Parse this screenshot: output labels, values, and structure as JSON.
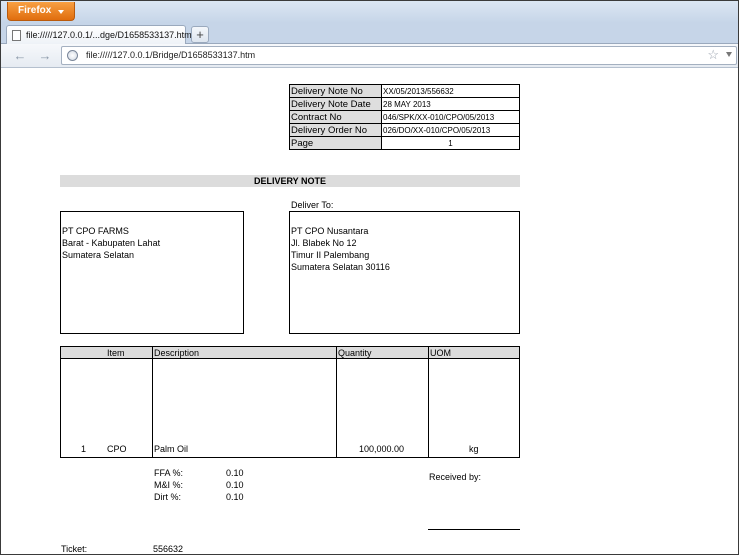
{
  "browser": {
    "app_button": "Firefox",
    "tab_title": "file://///127.0.0.1/...dge/D1658533137.htm",
    "new_tab": "+",
    "back": "←",
    "forward": "→",
    "url": "file://///127.0.0.1/Bridge/D1658533137.htm",
    "star": "☆"
  },
  "info_table": [
    {
      "label": "Delivery Note No",
      "value": "XX/05/2013/556632"
    },
    {
      "label": "Delivery Note Date",
      "value": "28 MAY 2013"
    },
    {
      "label": "Contract No",
      "value": "046/SPK/XX-010/CPO/05/2013"
    },
    {
      "label": "Delivery Order No",
      "value": "026/DO/XX-010/CPO/05/2013"
    },
    {
      "label": "Page",
      "value": "1"
    }
  ],
  "document_title": "DELIVERY NOTE",
  "deliver_to_label": "Deliver To:",
  "from_address": {
    "line1": "PT CPO FARMS",
    "line2": "Barat - Kabupaten Lahat",
    "line3": "Sumatera Selatan"
  },
  "to_address": {
    "line1": "PT CPO Nusantara",
    "line2": "Jl. Blabek No 12",
    "line3": "Timur II Palembang",
    "line4": "Sumatera Selatan 30116"
  },
  "items_table": {
    "headers": {
      "item": "Item",
      "description": "Description",
      "quantity": "Quantity",
      "uom": "UOM"
    },
    "row": {
      "number": "1",
      "item": "CPO",
      "description": "Palm Oil",
      "quantity": "100,000.00",
      "uom": "kg",
      "specs": [
        {
          "label": "FFA %:",
          "value": "0.10"
        },
        {
          "label": "M&I %:",
          "value": "0.10"
        },
        {
          "label": "Dirt %:",
          "value": "0.10"
        }
      ]
    }
  },
  "received_by": "Received by:",
  "ticket_label": "Ticket:",
  "ticket_value": "556632"
}
